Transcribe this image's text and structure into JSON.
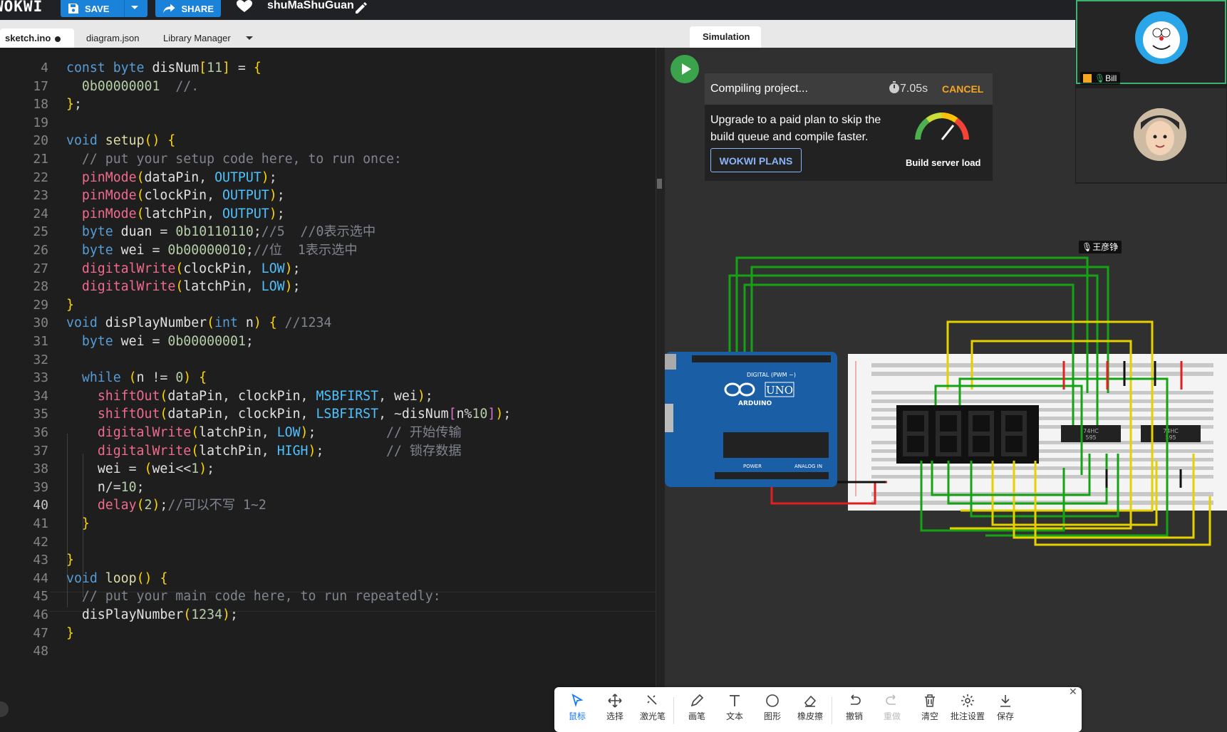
{
  "topbar": {
    "logo": "WOKWI",
    "save_label": "SAVE",
    "share_label": "SHARE",
    "project_name": "shuMaShuGuan"
  },
  "editor_tabs": [
    "sketch.ino",
    "diagram.json",
    "Library Manager"
  ],
  "sim_tab": "Simulation",
  "editor": {
    "active_line": "40",
    "lines": [
      {
        "n": "4",
        "t": "const byte disNum[11] = {"
      },
      {
        "n": "17",
        "t": "  0b00000001  //."
      },
      {
        "n": "18",
        "t": "};"
      },
      {
        "n": "19",
        "t": ""
      },
      {
        "n": "20",
        "t": "void setup() {"
      },
      {
        "n": "21",
        "t": "  // put your setup code here, to run once:"
      },
      {
        "n": "22",
        "t": "  pinMode(dataPin, OUTPUT);"
      },
      {
        "n": "23",
        "t": "  pinMode(clockPin, OUTPUT);"
      },
      {
        "n": "24",
        "t": "  pinMode(latchPin, OUTPUT);"
      },
      {
        "n": "25",
        "t": "  byte duan = 0b10110110;//5  //0表示选中"
      },
      {
        "n": "26",
        "t": "  byte wei = 0b00000010;//位  1表示选中"
      },
      {
        "n": "27",
        "t": "  digitalWrite(clockPin, LOW);"
      },
      {
        "n": "28",
        "t": "  digitalWrite(latchPin, LOW);"
      },
      {
        "n": "29",
        "t": "}"
      },
      {
        "n": "30",
        "t": "void disPlayNumber(int n) { //1234"
      },
      {
        "n": "31",
        "t": "  byte wei = 0b00000001;"
      },
      {
        "n": "32",
        "t": ""
      },
      {
        "n": "33",
        "t": "  while (n != 0) {"
      },
      {
        "n": "34",
        "t": "    shiftOut(dataPin, clockPin, MSBFIRST, wei);"
      },
      {
        "n": "35",
        "t": "    shiftOut(dataPin, clockPin, LSBFIRST, ~disNum[n%10]);"
      },
      {
        "n": "36",
        "t": "    digitalWrite(latchPin, LOW);         // 开始传输"
      },
      {
        "n": "37",
        "t": "    digitalWrite(latchPin, HIGH);        // 锁存数据"
      },
      {
        "n": "38",
        "t": "    wei = (wei<<1);"
      },
      {
        "n": "39",
        "t": "    n/=10;"
      },
      {
        "n": "40",
        "t": "    delay(2);//可以不写 1~2"
      },
      {
        "n": "41",
        "t": "  }"
      },
      {
        "n": "42",
        "t": ""
      },
      {
        "n": "43",
        "t": "}"
      },
      {
        "n": "44",
        "t": "void loop() {"
      },
      {
        "n": "45",
        "t": "  // put your main code here, to run repeatedly:"
      },
      {
        "n": "46",
        "t": "  disPlayNumber(1234);"
      },
      {
        "n": "47",
        "t": "}"
      },
      {
        "n": "48",
        "t": ""
      }
    ]
  },
  "compile": {
    "status": "Compiling project...",
    "time": "7.05s",
    "cancel_label": "CANCEL",
    "upgrade_text": "Upgrade to a paid plan to skip the build queue and compile faster.",
    "plans_label": "WOKWI PLANS",
    "gauge_label": "Build server load"
  },
  "board": {
    "model": "UNO",
    "brand": "ARDUINO",
    "digital_label": "DIGITAL (PWM ~)",
    "power_label": "POWER",
    "analog_label": "ANALOG IN",
    "chip_label_1": "74HC",
    "chip_code_1": "595",
    "chip_label_2": "74HC",
    "chip_code_2": "595"
  },
  "video": {
    "participants": [
      {
        "name": "Bill"
      },
      {
        "name": "王彦铮"
      }
    ]
  },
  "annotation_tools": [
    {
      "label": "鼠标",
      "icon": "cursor-icon"
    },
    {
      "label": "选择",
      "icon": "move-icon"
    },
    {
      "label": "激光笔",
      "icon": "laser-icon"
    },
    {
      "label": "画笔",
      "icon": "pen-icon"
    },
    {
      "label": "文本",
      "icon": "text-icon"
    },
    {
      "label": "图形",
      "icon": "shape-icon"
    },
    {
      "label": "橡皮擦",
      "icon": "eraser-icon"
    },
    {
      "label": "撤销",
      "icon": "undo-icon"
    },
    {
      "label": "重做",
      "icon": "redo-icon"
    },
    {
      "label": "清空",
      "icon": "trash-icon"
    },
    {
      "label": "批注设置",
      "icon": "gear-icon"
    },
    {
      "label": "保存",
      "icon": "download-icon"
    }
  ],
  "colors": {
    "accent_blue": "#1a82d8",
    "run_green": "#3aa34b",
    "cancel_orange": "#f5a623",
    "selected_tool": "#1677ff"
  }
}
